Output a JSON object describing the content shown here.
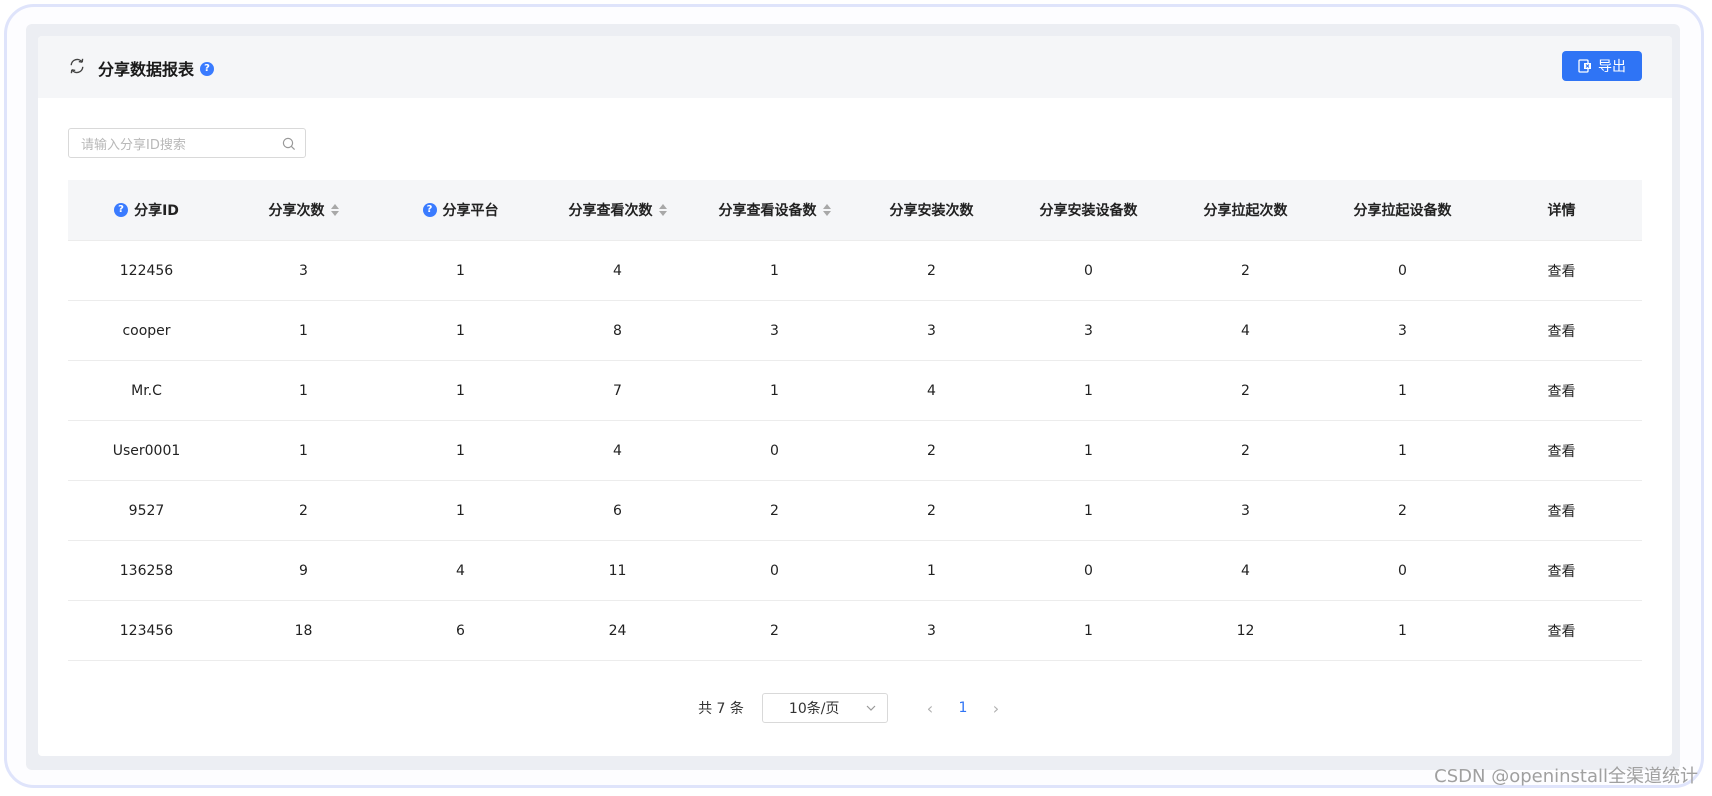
{
  "header": {
    "title": "分享数据报表",
    "help_glyph": "?",
    "export_label": "导出"
  },
  "search": {
    "placeholder": "请输入分享ID搜索",
    "value": ""
  },
  "table": {
    "columns": [
      {
        "label": "分享ID",
        "help": true,
        "sortable": false
      },
      {
        "label": "分享次数",
        "help": false,
        "sortable": true
      },
      {
        "label": "分享平台",
        "help": true,
        "sortable": false
      },
      {
        "label": "分享查看次数",
        "help": false,
        "sortable": true
      },
      {
        "label": "分享查看设备数",
        "help": false,
        "sortable": true
      },
      {
        "label": "分享安装次数",
        "help": false,
        "sortable": false
      },
      {
        "label": "分享安装设备数",
        "help": false,
        "sortable": false
      },
      {
        "label": "分享拉起次数",
        "help": false,
        "sortable": false
      },
      {
        "label": "分享拉起设备数",
        "help": false,
        "sortable": false
      },
      {
        "label": "详情",
        "help": false,
        "sortable": false
      }
    ],
    "rows": [
      {
        "share_id": "122456",
        "share_count": "3",
        "platform": "1",
        "view_count": "4",
        "view_devices": "1",
        "install_count": "2",
        "install_devices": "0",
        "launch_count": "2",
        "launch_devices": "0",
        "detail": "查看"
      },
      {
        "share_id": "cooper",
        "share_count": "1",
        "platform": "1",
        "view_count": "8",
        "view_devices": "3",
        "install_count": "3",
        "install_devices": "3",
        "launch_count": "4",
        "launch_devices": "3",
        "detail": "查看"
      },
      {
        "share_id": "Mr.C",
        "share_count": "1",
        "platform": "1",
        "view_count": "7",
        "view_devices": "1",
        "install_count": "4",
        "install_devices": "1",
        "launch_count": "2",
        "launch_devices": "1",
        "detail": "查看"
      },
      {
        "share_id": "User0001",
        "share_count": "1",
        "platform": "1",
        "view_count": "4",
        "view_devices": "0",
        "install_count": "2",
        "install_devices": "1",
        "launch_count": "2",
        "launch_devices": "1",
        "detail": "查看"
      },
      {
        "share_id": "9527",
        "share_count": "2",
        "platform": "1",
        "view_count": "6",
        "view_devices": "2",
        "install_count": "2",
        "install_devices": "1",
        "launch_count": "3",
        "launch_devices": "2",
        "detail": "查看"
      },
      {
        "share_id": "136258",
        "share_count": "9",
        "platform": "4",
        "view_count": "11",
        "view_devices": "0",
        "install_count": "1",
        "install_devices": "0",
        "launch_count": "4",
        "launch_devices": "0",
        "detail": "查看"
      },
      {
        "share_id": "123456",
        "share_count": "18",
        "platform": "6",
        "view_count": "24",
        "view_devices": "2",
        "install_count": "3",
        "install_devices": "1",
        "launch_count": "12",
        "launch_devices": "1",
        "detail": "查看"
      }
    ]
  },
  "pagination": {
    "total_text": "共 7 条",
    "page_size": "10条/页",
    "current_page": "1",
    "prev_glyph": "‹",
    "next_glyph": "›"
  },
  "watermark": "CSDN @openinstall全渠道统计",
  "colors": {
    "accent": "#2f74f5",
    "header_bg": "#f5f6f8",
    "frame_border": "#dfe4fb"
  }
}
